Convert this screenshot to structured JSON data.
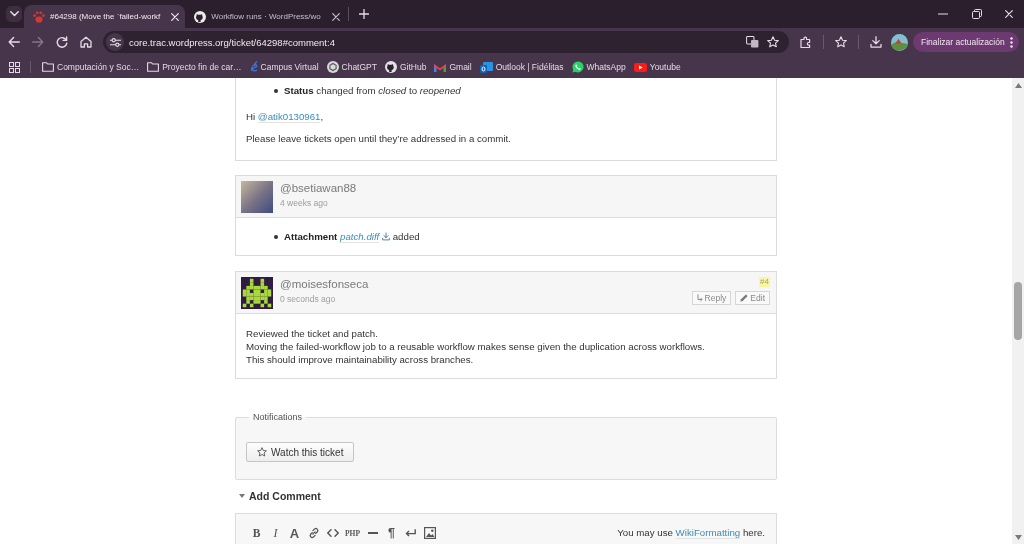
{
  "browser": {
    "tabs": [
      {
        "title": "#64298 (Move the `failed-workf",
        "selected": true
      },
      {
        "title": "Workflow runs · WordPress/wo",
        "selected": false
      }
    ],
    "navigation": [
      {
        "disabled": false
      },
      {
        "disabled": true
      },
      {
        "disabled": false
      },
      {
        "disabled": false
      }
    ],
    "address": "core.trac.wordpress.org/ticket/64298#comment:4",
    "update_button": "Finalizar actualización",
    "bookmarks": [
      "Computación y Soc…",
      "Proyecto fin de car…",
      "Campus Virtual",
      "ChatGPT",
      "GitHub",
      "Gmail",
      "Outlook | Fidélitas",
      "WhatsApp",
      "Youtube"
    ]
  },
  "ticket": {
    "comments": [
      {
        "kind": "continued",
        "changes": [
          {
            "kind": "change",
            "field": "Status",
            "text": "changed from *closed* to *reopened*"
          }
        ],
        "paragraphs": [
          {
            "text": "Hi",
            "mention": "@atik0130961",
            "after": ","
          },
          {
            "text": "Please leave tickets open until they’re addressed in a commit."
          }
        ]
      },
      {
        "kind": "full",
        "avatar": {
          "kind": "photo"
        },
        "author": "@bsetiawan88",
        "time": "4 weeks ago",
        "changes": [
          {
            "kind": "attachment",
            "field": "Attachment",
            "link": "patch.diff",
            "text": "added"
          }
        ]
      },
      {
        "kind": "full",
        "avatar": {
          "kind": "pixel-art"
        },
        "author": "@moisesfonseca",
        "time": "0 seconds ago",
        "number": "#4",
        "highlighted": true,
        "actions": [
          {
            "kind": "reply",
            "label": "Reply"
          },
          {
            "kind": "edit",
            "label": "Edit"
          }
        ],
        "lines": [
          "Reviewed the ticket and patch.",
          "Moving the failed-workflow job to a reusable workflow makes sense given the duplication across workflows.",
          "This should improve maintainability across branches."
        ]
      }
    ]
  },
  "notifications": {
    "legend": "Notifications",
    "button": "Watch this ticket"
  },
  "add_comment": {
    "title": "Add Comment",
    "expanded": true,
    "toolbar": [
      {
        "kind": "bold",
        "label": "B"
      },
      {
        "kind": "italic",
        "label": "I"
      },
      {
        "kind": "heading",
        "label": "A"
      },
      {
        "kind": "link"
      },
      {
        "kind": "code"
      },
      {
        "kind": "php",
        "label": "PHP"
      },
      {
        "kind": "rule"
      },
      {
        "kind": "paragraph",
        "label": "¶"
      },
      {
        "kind": "linebreak"
      },
      {
        "kind": "image"
      }
    ],
    "hint": {
      "text": "You may use",
      "link": "WikiFormatting",
      "after": "here."
    }
  }
}
